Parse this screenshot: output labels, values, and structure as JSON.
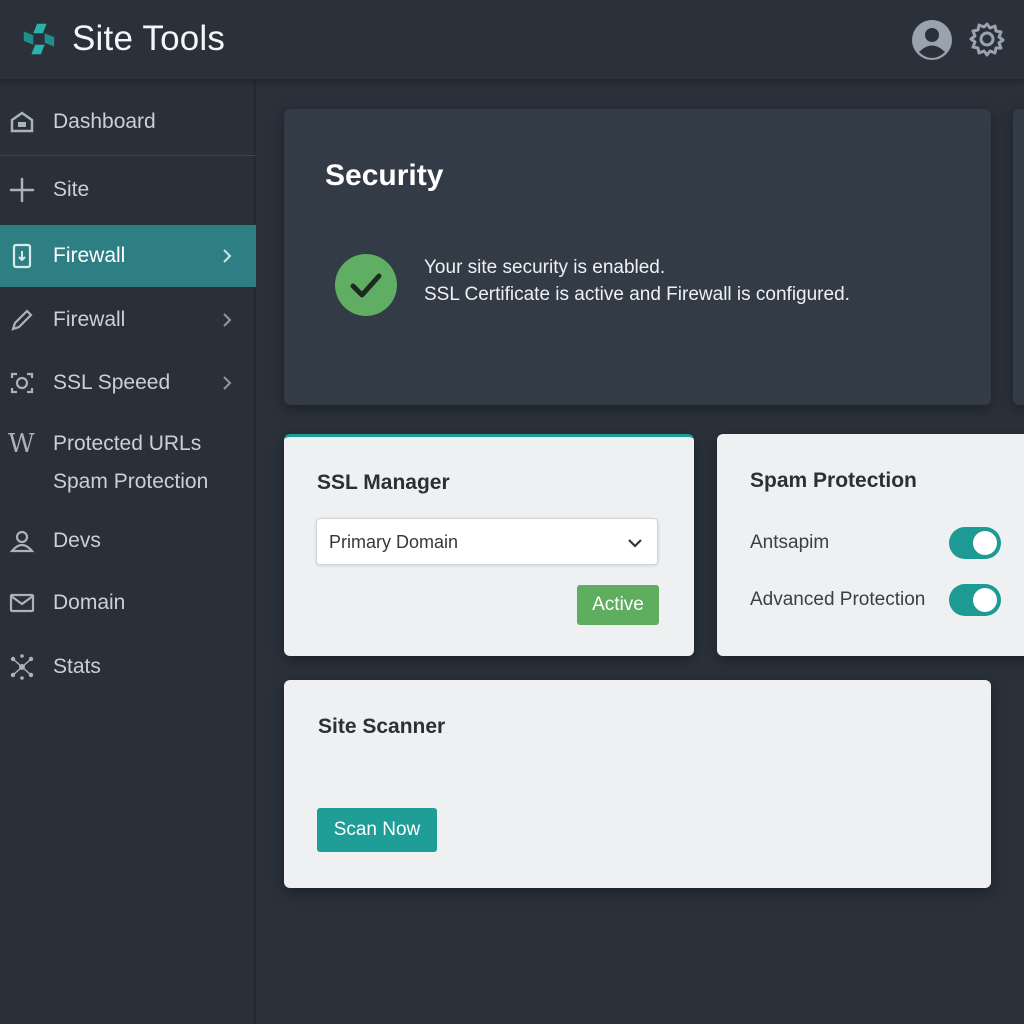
{
  "header": {
    "title": "Site Tools",
    "logo_icon": "pinwheel-logo-icon",
    "user_icon": "user-avatar-icon",
    "settings_icon": "gear-icon"
  },
  "sidebar": {
    "items": [
      {
        "label": "Dashboard",
        "icon": "dashboard-icon",
        "chevron": false,
        "active": false
      },
      {
        "label": "Site",
        "icon": "move-arrows-icon",
        "chevron": false,
        "active": false
      },
      {
        "label": "Firewall",
        "icon": "file-icon",
        "chevron": true,
        "active": true
      },
      {
        "label": "Firewall",
        "icon": "pencil-icon",
        "chevron": true,
        "active": false
      },
      {
        "label": "SSL Speeed",
        "icon": "camera-icon",
        "chevron": true,
        "active": false
      },
      {
        "label": "Protected URLs",
        "label2": "Spam Protection",
        "icon": "wordpress-w-icon",
        "chevron": false,
        "active": false
      },
      {
        "label": "Devs",
        "icon": "user-outline-icon",
        "chevron": false,
        "active": false
      },
      {
        "label": "Domain",
        "icon": "mail-icon",
        "chevron": false,
        "active": false
      },
      {
        "label": "Stats",
        "icon": "network-icon",
        "chevron": false,
        "active": false
      }
    ]
  },
  "security": {
    "title": "Security",
    "status_line1": "Your site security is enabled.",
    "status_line2": "SSL Certificate is active and Firewall is configured.",
    "status_icon": "check-circle-icon"
  },
  "ssl_manager": {
    "title": "SSL Manager",
    "select_value": "Primary Domain",
    "status_button": "Active"
  },
  "spam_protection": {
    "title": "Spam Protection",
    "toggles": [
      {
        "label": "Antsapim",
        "on": true
      },
      {
        "label": "Advanced Protection",
        "on": true
      }
    ]
  },
  "site_scanner": {
    "title": "Site Scanner",
    "button": "Scan Now"
  },
  "colors": {
    "accent": "#1f9d97",
    "active_nav": "#2d7f83",
    "success": "#5fad5f",
    "background": "#2a313b"
  }
}
